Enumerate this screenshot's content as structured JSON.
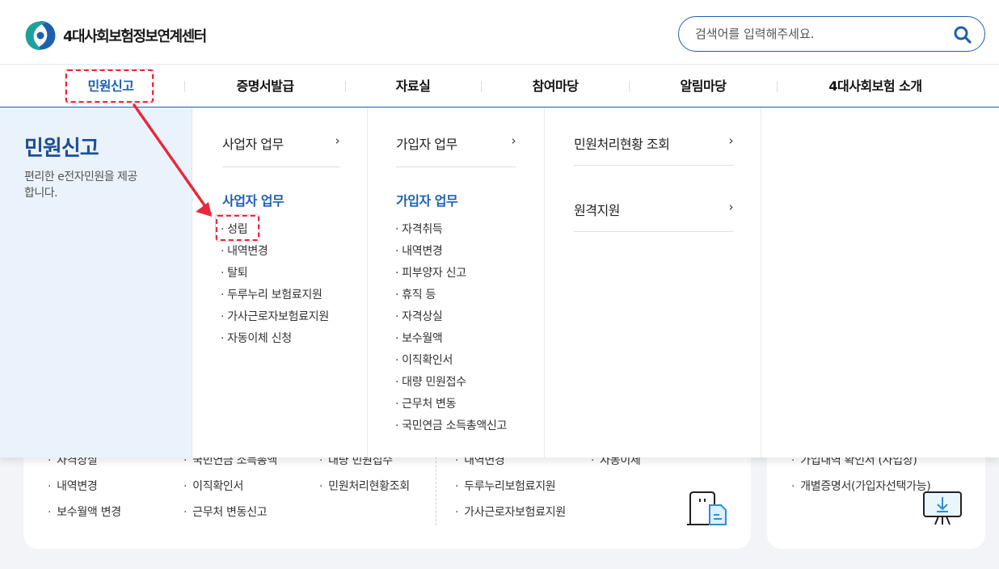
{
  "brand": {
    "name": "4대사회보험정보연계센터",
    "colors": {
      "primary": "#1d5fb0",
      "teal": "#1aa39a",
      "annotation": "#e8283a"
    }
  },
  "search": {
    "placeholder": "검색어를 입력해주세요.",
    "icon": "search-icon"
  },
  "gnb": [
    {
      "label": "민원신고",
      "active": true
    },
    {
      "label": "증명서발급"
    },
    {
      "label": "자료실"
    },
    {
      "label": "참여마당"
    },
    {
      "label": "알림마당"
    },
    {
      "label": "4대사회보험 소개"
    }
  ],
  "mega": {
    "side": {
      "title": "민원신고",
      "desc": "편리한 e전자민원을 제공합니다."
    },
    "columns": [
      {
        "head": "사업자 업무",
        "sub_title": "사업자 업무",
        "items": [
          "성립",
          "내역변경",
          "탈퇴",
          "두루누리 보험료지원",
          "가사근로자보험료지원",
          "자동이체 신청"
        ]
      },
      {
        "head": "가입자 업무",
        "sub_title": "가입자 업무",
        "items": [
          "자격취득",
          "내역변경",
          "피부양자 신고",
          "휴직 등",
          "자격상실",
          "보수월액",
          "이직확인서",
          "대량 민원접수",
          "근무처 변동",
          "국민연금 소득총액신고"
        ]
      },
      {
        "heads": [
          "민원처리현황 조회",
          "원격지원"
        ]
      }
    ],
    "chevron": "›"
  },
  "background": {
    "partial_row": [
      "자격상실",
      "국민연금 소득총액",
      "대량 민원접수",
      "내역변경",
      "자동이체",
      "가입내역 확인서 (사업장)"
    ],
    "row2": [
      "내역변경",
      "이직확인서",
      "민원처리현황조회",
      "두루누리보험료지원",
      "개별증명서(가입자선택가능)"
    ],
    "row3": [
      "보수월액 변경",
      "근무처 변동신고",
      "가사근로자보험료지원"
    ]
  }
}
